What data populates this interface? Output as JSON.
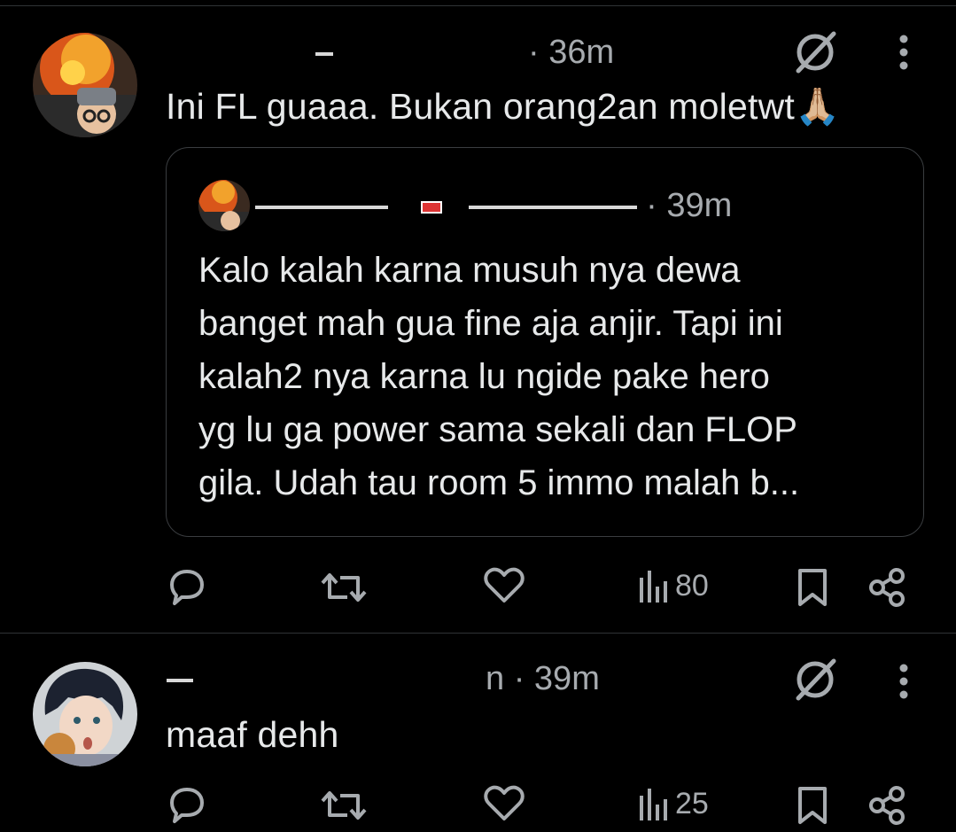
{
  "tweets": [
    {
      "handle_suffix": "·",
      "time": "36m",
      "text": "Ini FL guaaa. Bukan orang2an moletwt",
      "emoji": "🙏🏼",
      "quote": {
        "time": "39m",
        "lines": [
          "Kalo kalah karna musuh nya dewa",
          "banget mah gua fine aja anjir. Tapi ini",
          "kalah2 nya karna lu ngide pake hero",
          "yg lu ga power sama sekali dan FLOP",
          "gila. Udah tau room 5 immo malah b..."
        ]
      },
      "actions": {
        "views": "80"
      }
    },
    {
      "handle_fragment": "n",
      "time": "39m",
      "text": "maaf dehh",
      "actions": {
        "views": "25"
      }
    }
  ],
  "icons": [
    "grok-icon",
    "more-icon",
    "reply-icon",
    "repost-icon",
    "like-icon",
    "views-icon",
    "bookmark-icon",
    "share-icon"
  ],
  "colors": {
    "background": "#000000",
    "text": "#e7e9ea",
    "muted": "#a7abaf",
    "border": "#2f3336"
  }
}
